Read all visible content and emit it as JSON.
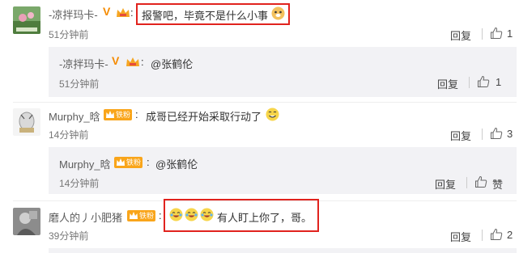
{
  "comments": [
    {
      "username": "-凉拌玛卡-",
      "v_badge": "V",
      "text": "报警吧，毕竟不是什么小事",
      "time": "51分钟前",
      "reply_label": "回复",
      "like_count": "1",
      "reply": {
        "username": "-凉拌玛卡-",
        "v_badge": "V",
        "text": "@张鹤伦",
        "time": "51分钟前",
        "reply_label": "回复",
        "like_count": "1"
      }
    },
    {
      "username": "Murphy_晗",
      "fan_badge": "铁粉",
      "text": "成哥已经开始采取行动了",
      "time": "14分钟前",
      "reply_label": "回复",
      "like_count": "3",
      "reply": {
        "username": "Murphy_晗",
        "fan_badge": "铁粉",
        "text": "@张鹤伦",
        "time": "14分钟前",
        "reply_label": "回复",
        "like_label": "赞"
      }
    },
    {
      "username": "磨人的丿小肥猪",
      "fan_badge": "铁粉",
      "text": "有人盯上你了，哥。",
      "time": "39分钟前",
      "reply_label": "回复",
      "like_count": "2"
    }
  ],
  "colors": {
    "highlight_border": "#e1231e",
    "v_badge": "#f58b00",
    "fan_badge": "#f9a51a",
    "reply_bg": "#f2f2f5"
  },
  "icons": [
    "thumb-up-icon",
    "crown-icon",
    "doge-emoji-icon",
    "grin-emoji-icon",
    "laugh-cry-emoji-icon"
  ]
}
